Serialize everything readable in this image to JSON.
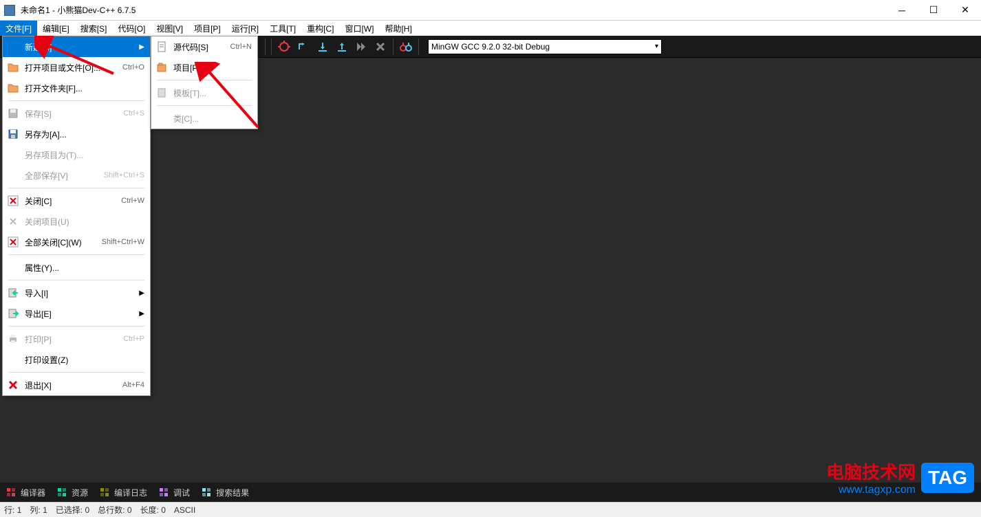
{
  "titlebar": {
    "text": "未命名1 - 小熊猫Dev-C++ 6.7.5"
  },
  "menubar": {
    "items": [
      {
        "label": "文件[F]",
        "active": true
      },
      {
        "label": "编辑[E]"
      },
      {
        "label": "搜索[S]"
      },
      {
        "label": "代码[O]"
      },
      {
        "label": "视图[V]"
      },
      {
        "label": "项目[P]"
      },
      {
        "label": "运行[R]"
      },
      {
        "label": "工具[T]"
      },
      {
        "label": "重构[C]"
      },
      {
        "label": "窗口[W]"
      },
      {
        "label": "帮助[H]"
      }
    ]
  },
  "toolbar": {
    "compiler": "MinGW GCC 9.2.0 32-bit Debug"
  },
  "file_menu": {
    "items": [
      {
        "label": "新建[N]",
        "shortcut": "",
        "arrow": true,
        "highlighted": true,
        "icon": ""
      },
      {
        "label": "打开项目或文件[O]...",
        "shortcut": "Ctrl+O",
        "icon": "folder"
      },
      {
        "label": "打开文件夹[F]...",
        "shortcut": "",
        "icon": "folder"
      },
      {
        "sep": true
      },
      {
        "label": "保存[S]",
        "shortcut": "Ctrl+S",
        "disabled": true,
        "icon": "save-gray"
      },
      {
        "label": "另存为[A]...",
        "shortcut": "",
        "icon": "save"
      },
      {
        "label": "另存项目为(T)...",
        "shortcut": "",
        "disabled": true
      },
      {
        "label": "全部保存[V]",
        "shortcut": "Shift+Ctrl+S",
        "disabled": true
      },
      {
        "sep": true
      },
      {
        "label": "关闭[C]",
        "shortcut": "Ctrl+W",
        "icon": "close-red"
      },
      {
        "label": "关闭项目(U)",
        "shortcut": "",
        "disabled": true,
        "icon": "close-gray"
      },
      {
        "label": "全部关闭[C](W)",
        "shortcut": "Shift+Ctrl+W",
        "icon": "close-red"
      },
      {
        "sep": true
      },
      {
        "label": "属性(Y)...",
        "shortcut": ""
      },
      {
        "sep": true
      },
      {
        "label": "导入[I]",
        "shortcut": "",
        "arrow": true,
        "icon": "import"
      },
      {
        "label": "导出[E]",
        "shortcut": "",
        "arrow": true,
        "icon": "export"
      },
      {
        "sep": true
      },
      {
        "label": "打印[P]",
        "shortcut": "Ctrl+P",
        "disabled": true,
        "icon": "print"
      },
      {
        "label": "打印设置(Z)",
        "shortcut": ""
      },
      {
        "sep": true
      },
      {
        "label": "退出[X]",
        "shortcut": "Alt+F4",
        "icon": "exit"
      }
    ]
  },
  "submenu": {
    "items": [
      {
        "label": "源代码[S]",
        "shortcut": "Ctrl+N",
        "icon": "doc"
      },
      {
        "label": "项目[P]...",
        "shortcut": "",
        "icon": "project"
      },
      {
        "sep": true
      },
      {
        "label": "模板[T]...",
        "shortcut": "",
        "disabled": true,
        "icon": "template"
      },
      {
        "sep": true
      },
      {
        "label": "类[C]...",
        "shortcut": "",
        "disabled": true
      }
    ]
  },
  "bottom_tabs": {
    "items": [
      {
        "label": "编译器",
        "color": "#e63946"
      },
      {
        "label": "资源",
        "color": "#06d6a0"
      },
      {
        "label": "编译日志",
        "color": "#8b8b00"
      },
      {
        "label": "调试",
        "color": "#c77dff"
      },
      {
        "label": "搜索结果",
        "color": "#90e0ef"
      }
    ]
  },
  "statusbar": {
    "line_label": "行:",
    "line_val": "1",
    "col_label": "列:",
    "col_val": "1",
    "sel_label": "已选择:",
    "sel_val": "0",
    "total_label": "总行数:",
    "total_val": "0",
    "len_label": "长度:",
    "len_val": "0",
    "encoding": "ASCII"
  },
  "watermark": {
    "title": "电脑技术网",
    "url": "www.tagxp.com",
    "tag": "TAG"
  }
}
